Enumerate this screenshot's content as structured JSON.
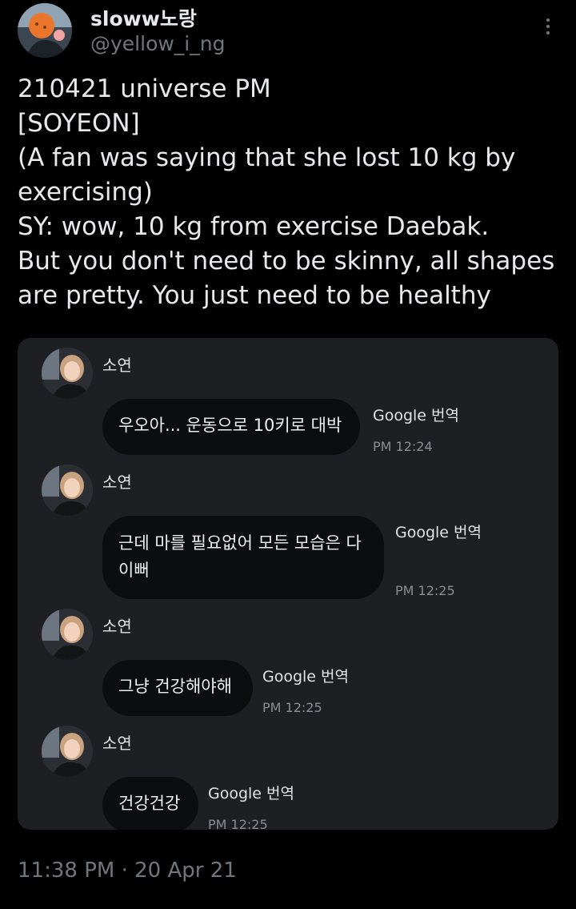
{
  "user": {
    "display_name": "sloww노랑",
    "handle": "@yellow_i_ng"
  },
  "tweet": {
    "lines": [
      "210421 universe PM",
      "[SOYEON]",
      "(A fan was saying that she lost 10 kg by",
      "exercising)",
      "SY: wow, 10 kg from exercise Daebak.",
      "But you don't need to be skinny, all shapes",
      "are pretty. You just need to be healthy"
    ],
    "timestamp": "11:38 PM · 20 Apr 21"
  },
  "chat": {
    "messages": [
      {
        "sender": "소연",
        "text": "우오아... 운동으로 10키로 대박",
        "translate": "Google 번역",
        "time": "PM 12:24"
      },
      {
        "sender": "소연",
        "text": "근데 마를 필요없어 모든 모습은 다 이뻐",
        "translate": "Google 번역",
        "time": "PM 12:25"
      },
      {
        "sender": "소연",
        "text": "그냥 건강해야해",
        "translate": "Google 번역",
        "time": "PM 12:25"
      },
      {
        "sender": "소연",
        "text": "건강건강",
        "translate": "Google 번역",
        "time": "PM 12:25"
      }
    ]
  },
  "icons": {
    "more": "more-vertical-icon"
  },
  "colors": {
    "background": "#000000",
    "text_primary": "#e7e9ea",
    "text_secondary": "#71767b",
    "chat_background": "#1d1f23",
    "bubble": "#0c0d0f"
  }
}
